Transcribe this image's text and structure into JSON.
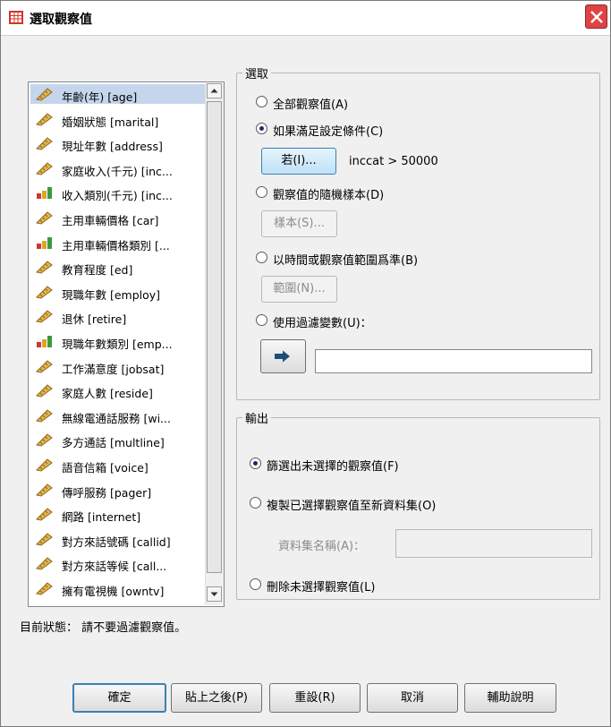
{
  "window": {
    "title": "選取觀察值",
    "colors": {
      "selection": "#c5d6ec",
      "accent_blue": "#3c7fb1",
      "close_red": "#e04343"
    }
  },
  "variables": {
    "items": [
      {
        "label": "年齡(年) [age]",
        "icon": "scale-ruler-icon",
        "selected": true
      },
      {
        "label": "婚姻狀態 [marital]",
        "icon": "scale-ruler-icon"
      },
      {
        "label": "現址年數 [address]",
        "icon": "scale-ruler-icon"
      },
      {
        "label": "家庭收入(千元) [inc...",
        "icon": "scale-ruler-icon"
      },
      {
        "label": "收入類別(千元) [inc...",
        "icon": "ordinal-bars-icon"
      },
      {
        "label": "主用車輛價格 [car]",
        "icon": "scale-ruler-icon"
      },
      {
        "label": "主用車輛價格類別 [...",
        "icon": "ordinal-bars-icon"
      },
      {
        "label": "教育程度 [ed]",
        "icon": "scale-ruler-icon"
      },
      {
        "label": "現職年數 [employ]",
        "icon": "scale-ruler-icon"
      },
      {
        "label": "退休 [retire]",
        "icon": "scale-ruler-icon"
      },
      {
        "label": "現職年數類別 [emp...",
        "icon": "ordinal-bars-icon"
      },
      {
        "label": "工作滿意度 [jobsat]",
        "icon": "scale-ruler-icon"
      },
      {
        "label": "家庭人數 [reside]",
        "icon": "scale-ruler-icon"
      },
      {
        "label": "無線電通話服務 [wi...",
        "icon": "scale-ruler-icon"
      },
      {
        "label": "多方通話 [multline]",
        "icon": "scale-ruler-icon"
      },
      {
        "label": "語音信箱 [voice]",
        "icon": "scale-ruler-icon"
      },
      {
        "label": "傳呼服務 [pager]",
        "icon": "scale-ruler-icon"
      },
      {
        "label": "網路 [internet]",
        "icon": "scale-ruler-icon"
      },
      {
        "label": "對方來話號碼 [callid]",
        "icon": "scale-ruler-icon"
      },
      {
        "label": "對方來話等候 [call...",
        "icon": "scale-ruler-icon"
      },
      {
        "label": "擁有電視機 [owntv]",
        "icon": "scale-ruler-icon"
      }
    ]
  },
  "select_group": {
    "title": "選取",
    "opt_all": "全部觀察值(A)",
    "opt_if": "如果滿足設定條件(C)",
    "if_button": "若(I)...",
    "condition": "inccat > 50000",
    "opt_random": "觀察值的隨機樣本(D)",
    "sample_button": "樣本(S)...",
    "opt_range": "以時間或觀察值範圍爲準(B)",
    "range_button": "範圍(N)...",
    "opt_filter": "使用過濾變數(U)：",
    "filter_value": "",
    "selected_option": "opt_if"
  },
  "output_group": {
    "title": "輸出",
    "opt_filter_out": "篩選出未選擇的觀察值(F)",
    "opt_copy": "複製已選擇觀察值至新資料集(O)",
    "dataset_label": "資料集名稱(A)：",
    "dataset_value": "",
    "opt_delete": "刪除未選擇觀察值(L)",
    "selected_option": "opt_filter_out"
  },
  "status": "目前狀態： 請不要過濾觀察值。",
  "buttons": {
    "ok": "確定",
    "paste": "貼上之後(P)",
    "reset": "重設(R)",
    "cancel": "取消",
    "help": "輔助說明"
  }
}
